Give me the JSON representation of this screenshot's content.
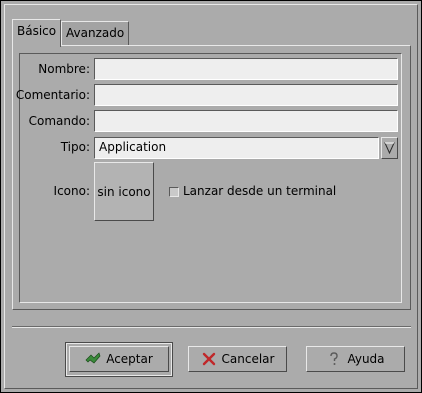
{
  "tabs": [
    {
      "label": "Básico",
      "active": true
    },
    {
      "label": "Avanzado",
      "active": false
    }
  ],
  "form": {
    "name_label": "Nombre:",
    "name_value": "",
    "comment_label": "Comentario:",
    "comment_value": "",
    "command_label": "Comando:",
    "command_value": "",
    "type_label": "Tipo:",
    "type_value": "Application",
    "icon_label": "Icono:",
    "icon_button_label": "sin icono",
    "terminal_label": "Lanzar desde un terminal",
    "terminal_checked": false
  },
  "buttons": {
    "ok_label": "Aceptar",
    "cancel_label": "Cancelar",
    "help_label": "Ayuda"
  },
  "icons": {
    "ok": "ok-check-icon",
    "cancel": "cancel-x-icon",
    "help": "help-question-icon",
    "combo": "dropdown-arrow-icon"
  },
  "colors": {
    "background": "#ababab",
    "entry_bg": "#eeeeee",
    "cancel_x": "#c0282a",
    "ok_check": "#3a8a3a"
  }
}
